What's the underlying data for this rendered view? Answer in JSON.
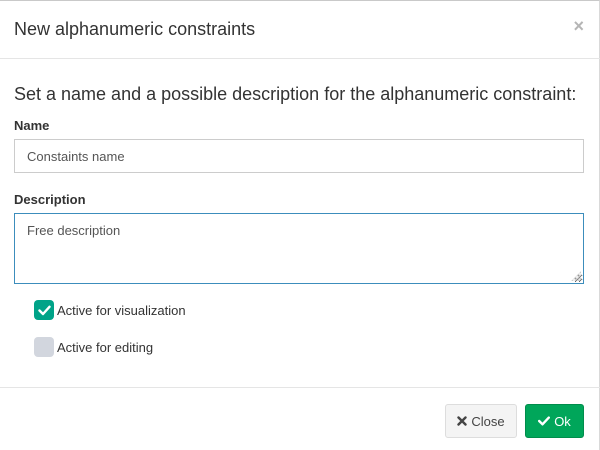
{
  "dialog": {
    "title": "New alphanumeric constraints",
    "close_symbol": "×",
    "prompt": "Set a name and a possible description for the alphanumeric constraint:"
  },
  "form": {
    "name_label": "Name",
    "name_value": "Constaints name",
    "description_label": "Description",
    "description_value": "Free description",
    "checkboxes": [
      {
        "label": "Active for visualization",
        "checked": true
      },
      {
        "label": "Active for editing",
        "checked": false
      }
    ]
  },
  "footer": {
    "close_label": "Close",
    "close_icon": "times-icon",
    "ok_label": "Ok",
    "ok_icon": "check-icon"
  },
  "colors": {
    "checkbox_on": "#00a388",
    "checkbox_off": "#d2d6de",
    "ok_button": "#00a65a",
    "focus_border": "#3c8dbc"
  }
}
